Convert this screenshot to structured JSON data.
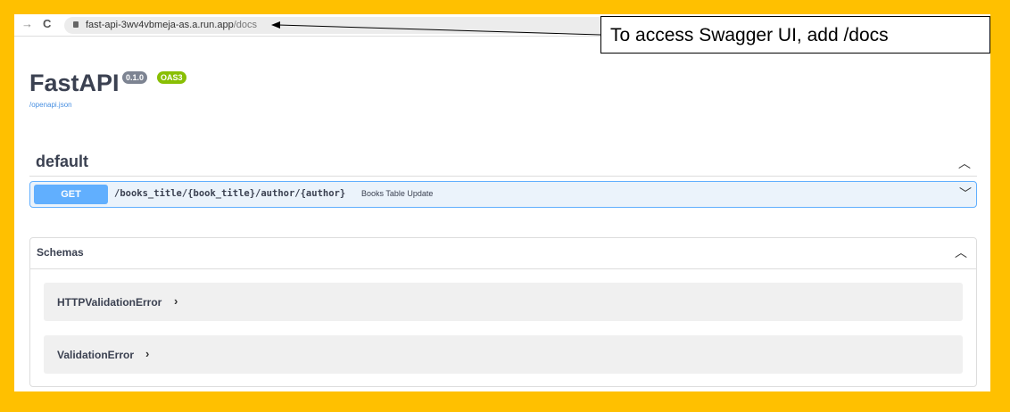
{
  "browser": {
    "url_host": "fast-api-3wv4vbmeja-as.a.run.app",
    "url_path": "/docs",
    "back": "→",
    "reload": "C"
  },
  "api": {
    "title": "FastAPI",
    "version": "0.1.0",
    "oas": "OAS3",
    "spec_link": "/openapi.json"
  },
  "tag": {
    "name": "default"
  },
  "operation": {
    "method": "GET",
    "path": "/books_title/{book_title}/author/{author}",
    "summary": "Books Table Update"
  },
  "schemas": {
    "title": "Schemas",
    "models": [
      {
        "name": "HTTPValidationError"
      },
      {
        "name": "ValidationError"
      }
    ]
  },
  "annotation": {
    "text": "To access Swagger UI, add  /docs"
  },
  "colors": {
    "frame": "#FFC000",
    "get": "#61affe",
    "oas": "#89bf04",
    "version": "#7d8492"
  }
}
